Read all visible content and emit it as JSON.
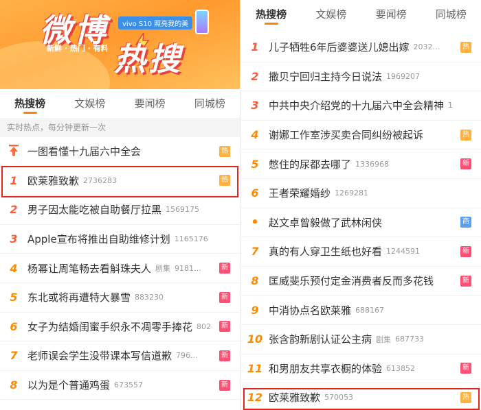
{
  "banner": {
    "logo_top": "微博",
    "logo_bottom": "热搜",
    "slogan": "新鲜 · 热门 · 有料",
    "ad_text": "vivo S10 照亮我的美"
  },
  "tabs": [
    "热搜榜",
    "文娱榜",
    "要闻榜",
    "同城榜"
  ],
  "subhead": "实时热点，每分钟更新一次",
  "left_list": [
    {
      "rank": "",
      "title": "一图看懂十九届六中全会",
      "cat": "",
      "num": "",
      "badge": "热",
      "badge_type": "hot",
      "pin": true
    },
    {
      "rank": "1",
      "title": "欧莱雅致歉",
      "cat": "",
      "num": "2736283",
      "badge": "热",
      "badge_type": "hot"
    },
    {
      "rank": "2",
      "title": "男子因太能吃被自助餐厅拉黑",
      "cat": "",
      "num": "1569175",
      "badge": "",
      "badge_type": ""
    },
    {
      "rank": "3",
      "title": "Apple宣布将推出自助维修计划",
      "cat": "",
      "num": "1165176",
      "badge": "",
      "badge_type": ""
    },
    {
      "rank": "4",
      "title": "杨幂让周笔畅去看斛珠夫人",
      "cat": "剧集",
      "num": "9181…",
      "badge": "新",
      "badge_type": "new"
    },
    {
      "rank": "5",
      "title": "东北或将再遭特大暴雪",
      "cat": "",
      "num": "883230",
      "badge": "新",
      "badge_type": "new"
    },
    {
      "rank": "6",
      "title": "女子为结婚闺蜜手织永不凋零手捧花",
      "cat": "",
      "num": "8024…",
      "badge": "新",
      "badge_type": "new"
    },
    {
      "rank": "7",
      "title": "老师误会学生没带课本写信道歉",
      "cat": "",
      "num": "796…",
      "badge": "新",
      "badge_type": "new"
    },
    {
      "rank": "8",
      "title": "以为是个普通鸡蛋",
      "cat": "",
      "num": "673557",
      "badge": "新",
      "badge_type": "new"
    }
  ],
  "right_list": [
    {
      "rank": "1",
      "title": "儿子牺牲6年后婆婆送儿媳出嫁",
      "cat": "",
      "num": "2032…",
      "badge": "热",
      "badge_type": "hot"
    },
    {
      "rank": "2",
      "title": "撒贝宁回归主持今日说法",
      "cat": "",
      "num": "1969207",
      "badge": "",
      "badge_type": ""
    },
    {
      "rank": "3",
      "title": "中共中央介绍党的十九届六中全会精神",
      "cat": "",
      "num": "1…",
      "badge": "",
      "badge_type": ""
    },
    {
      "rank": "4",
      "title": "谢娜工作室涉买卖合同纠纷被起诉",
      "cat": "",
      "num": "",
      "badge": "热",
      "badge_type": "hot"
    },
    {
      "rank": "5",
      "title": "憋住的尿都去哪了",
      "cat": "",
      "num": "1336968",
      "badge": "新",
      "badge_type": "new"
    },
    {
      "rank": "6",
      "title": "王者荣耀婚纱",
      "cat": "",
      "num": "1269281",
      "badge": "",
      "badge_type": ""
    },
    {
      "rank": "•",
      "title": "赵文卓曾毅做了武林闲侠",
      "cat": "",
      "num": "",
      "badge": "商",
      "badge_type": "ad2",
      "dot": true
    },
    {
      "rank": "7",
      "title": "真的有人穿卫生纸也好看",
      "cat": "",
      "num": "1244591",
      "badge": "新",
      "badge_type": "new"
    },
    {
      "rank": "8",
      "title": "匡威斐乐预付定金消费者反而多花钱",
      "cat": "",
      "num": "",
      "badge": "新",
      "badge_type": "new"
    },
    {
      "rank": "9",
      "title": "中消协点名欧莱雅",
      "cat": "",
      "num": "688167",
      "badge": "",
      "badge_type": ""
    },
    {
      "rank": "10",
      "title": "张含韵新剧认证公主病",
      "cat": "剧集",
      "num": "687733",
      "badge": "",
      "badge_type": ""
    },
    {
      "rank": "11",
      "title": "和男朋友共享衣橱的体验",
      "cat": "",
      "num": "613852",
      "badge": "新",
      "badge_type": "new"
    },
    {
      "rank": "12",
      "title": "欧莱雅致歉",
      "cat": "",
      "num": "570053",
      "badge": "热",
      "badge_type": "hot"
    }
  ]
}
